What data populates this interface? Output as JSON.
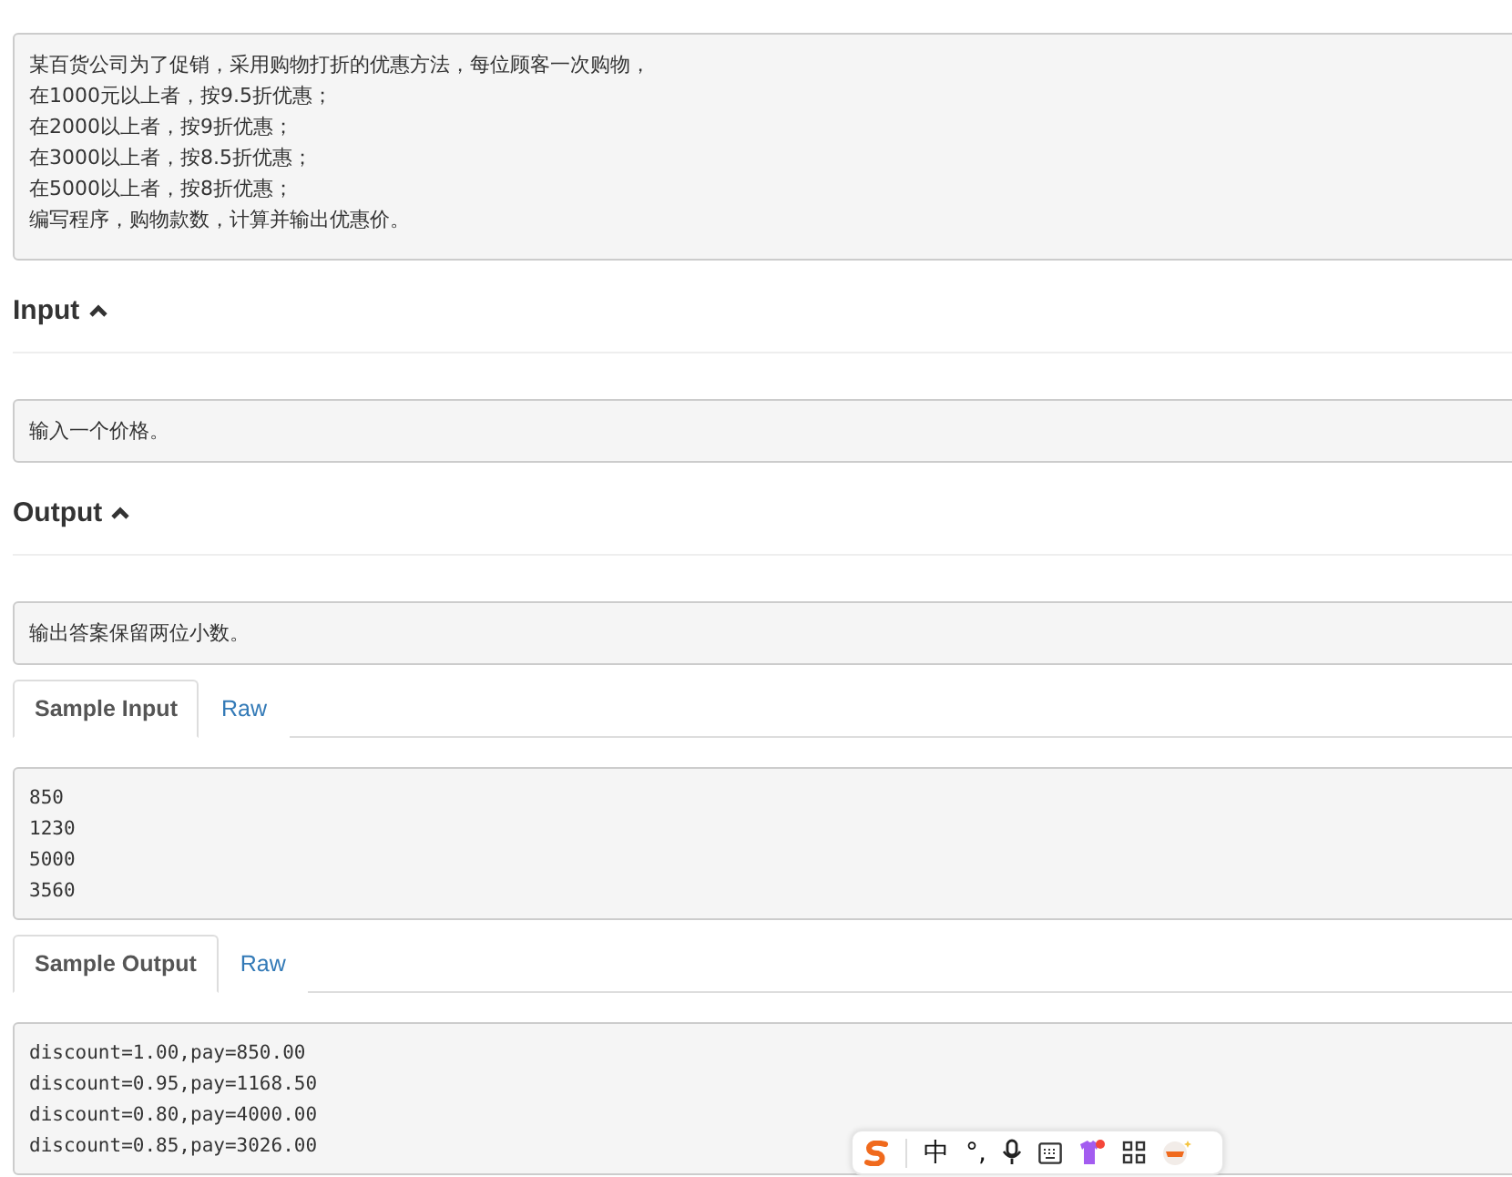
{
  "description": {
    "lines": [
      "某百货公司为了促销，采用购物打折的优惠方法，每位顾客一次购物，",
      "在1000元以上者，按9.5折优惠；",
      "在2000以上者，按9折优惠；",
      "在3000以上者，按8.5折优惠；",
      "在5000以上者，按8折优惠；",
      "编写程序，购物款数，计算并输出优惠价。"
    ]
  },
  "sections": [
    {
      "heading": "Input",
      "expanded": true,
      "text": "输入一个价格。"
    },
    {
      "heading": "Output",
      "expanded": true,
      "text": "输出答案保留两位小数。"
    }
  ],
  "samples": [
    {
      "tabs": [
        {
          "label": "Sample Input",
          "selected": true
        },
        {
          "label": "Raw",
          "selected": false
        }
      ],
      "lines": [
        "850",
        "1230",
        "5000",
        "3560"
      ]
    },
    {
      "tabs": [
        {
          "label": "Sample Output",
          "selected": true
        },
        {
          "label": "Raw",
          "selected": false
        }
      ],
      "lines": [
        "discount=1.00,pay=850.00",
        "discount=0.95,pay=1168.50",
        "discount=0.80,pay=4000.00",
        "discount=0.85,pay=3026.00"
      ]
    }
  ],
  "ime_toolbar": {
    "mode": "中",
    "punctuation": "°,"
  }
}
